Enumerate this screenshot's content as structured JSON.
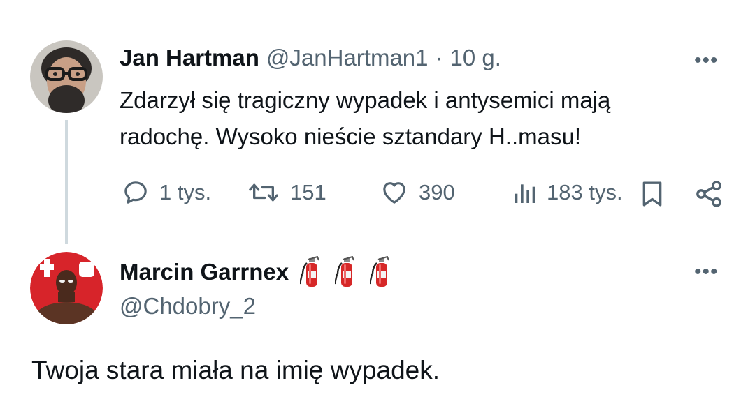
{
  "tweet": {
    "author_name": "Jan Hartman",
    "author_handle": "@JanHartman1",
    "separator": "·",
    "time": "10 g.",
    "text_line1": "Zdarzył się tragiczny wypadek i antysemici mają",
    "text_line2": "radochę. Wysoko nieście sztandary H..masu!",
    "actions": {
      "replies": "1 tys.",
      "retweets": "151",
      "likes": "390",
      "views": "183 tys."
    },
    "more_label": "•••"
  },
  "reply": {
    "author_name": "Marcin Garrnex",
    "name_emoji_icons": [
      "fire-extinguisher-icon",
      "fire-extinguisher-icon",
      "fire-extinguisher-icon"
    ],
    "author_handle": "@Chdobry_2",
    "text": "Twoja stara miała na imię wypadek.",
    "more_label": "•••"
  },
  "colors": {
    "text_primary": "#0f1419",
    "text_secondary": "#536471",
    "thread_line": "#cfd9de",
    "extinguisher_red": "#d62828"
  }
}
